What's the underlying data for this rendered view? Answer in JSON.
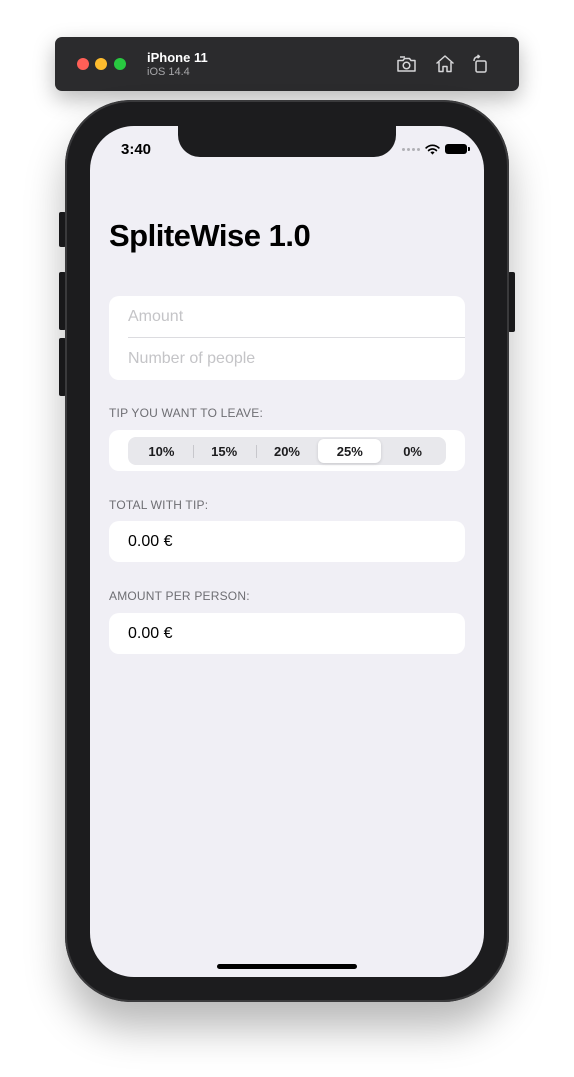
{
  "simulator": {
    "device_name": "iPhone 11",
    "os_version": "iOS 14.4",
    "toolbar_icons": [
      "screenshot-icon",
      "home-icon",
      "rotate-icon"
    ]
  },
  "status_bar": {
    "time": "3:40",
    "icons": [
      "cellular-dots-icon",
      "wifi-icon",
      "battery-icon"
    ]
  },
  "app": {
    "title": "SpliteWise 1.0",
    "amount_placeholder": "Amount",
    "amount_value": "",
    "people_placeholder": "Number of people",
    "people_value": "",
    "tip_label": "TIP YOU WANT TO LEAVE:",
    "tip_options": [
      "10%",
      "15%",
      "20%",
      "25%",
      "0%"
    ],
    "tip_selected": "25%",
    "total_label": "TOTAL WITH TIP:",
    "total_value": "0.00 €",
    "per_person_label": "AMOUNT PER PERSON:",
    "per_person_value": "0.00 €"
  },
  "colors": {
    "screen_background": "#f0eff5",
    "card_background": "#ffffff",
    "phone_frame": "#1c1c1e",
    "traffic_red": "#ff5f57",
    "traffic_yellow": "#febc2e",
    "traffic_green": "#28c840"
  }
}
